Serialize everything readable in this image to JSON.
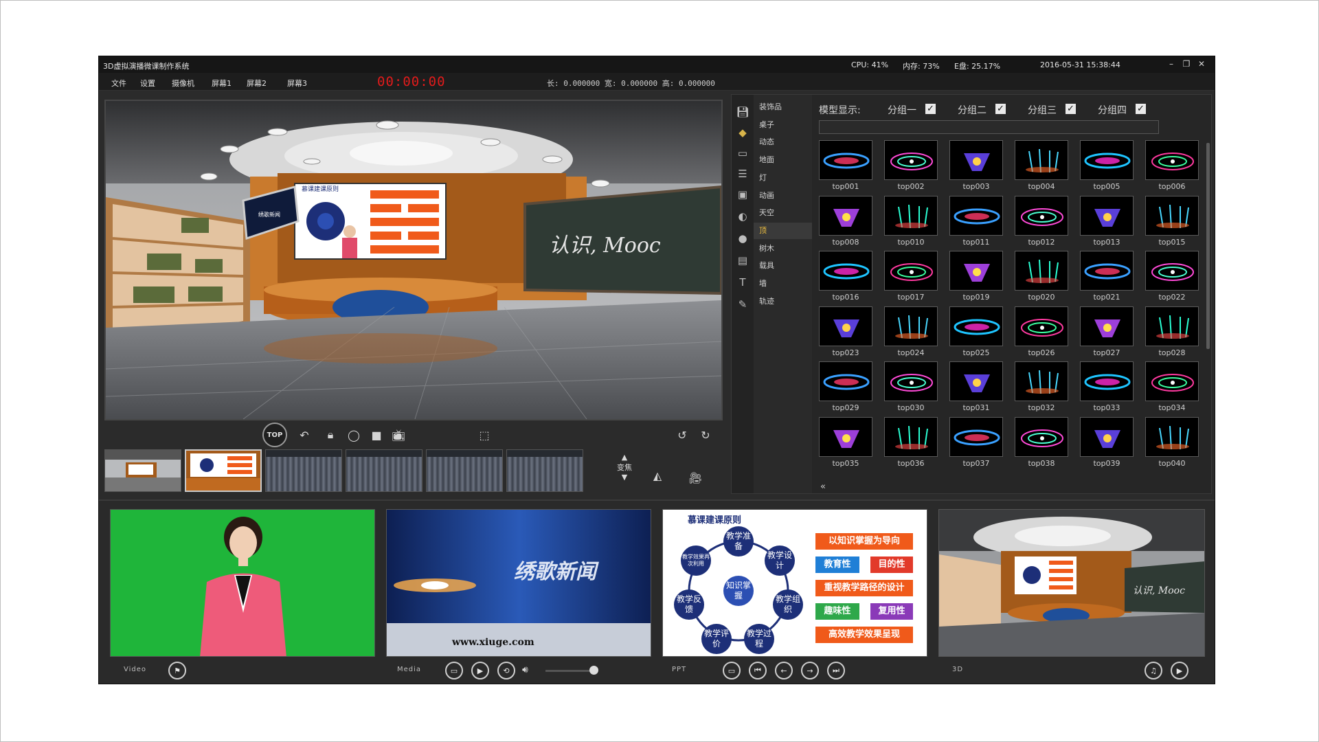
{
  "app": {
    "title": "3D虚拟演播微课制作系统",
    "cpu": "CPU: 41%",
    "memory": "内存: 73%",
    "disk": "E盘: 25.17%",
    "datetime": "2016-05-31 15:38:44"
  },
  "menu": {
    "items": [
      "文件",
      "设置",
      "摄像机",
      "屏幕1",
      "屏幕2",
      "屏幕3"
    ],
    "timer": "00:00:00",
    "dimensions": "长: 0.000000  宽: 0.000000  高: 0.000000"
  },
  "preview": {
    "blackboard_text": "认识, Mooc",
    "screen_title": "慕课建课原则",
    "tv_text": "绣歌新闻"
  },
  "toolbar": {
    "top_label": "TOP",
    "focus_label": "变焦"
  },
  "categories": [
    "装饰品",
    "桌子",
    "动态",
    "地面",
    "灯",
    "动画",
    "天空",
    "顶",
    "树木",
    "载具",
    "墙",
    "轨迹"
  ],
  "active_category": "顶",
  "model_display": {
    "label": "模型显示:",
    "groups": [
      "分组一",
      "分组二",
      "分组三",
      "分组四"
    ],
    "checked": [
      true,
      true,
      true,
      true
    ]
  },
  "models": [
    "top001",
    "top002",
    "top003",
    "top004",
    "top005",
    "top006",
    "top008",
    "top010",
    "top011",
    "top012",
    "top013",
    "top015",
    "top016",
    "top017",
    "top019",
    "top020",
    "top021",
    "top022",
    "top023",
    "top024",
    "top025",
    "top026",
    "top027",
    "top028",
    "top029",
    "top030",
    "top031",
    "top032",
    "top033",
    "top034",
    "top035",
    "top036",
    "top037",
    "top038",
    "top039",
    "top040"
  ],
  "bottom": {
    "video_label": "Video",
    "media_label": "Media",
    "ppt_label": "PPT",
    "threed_label": "3D",
    "media_title": "绣歌新闻",
    "media_url": "www.xiuge.com",
    "ppt": {
      "title": "慕课建课原则",
      "center": "知识掌握",
      "nodes": [
        "教学准备",
        "教学设计",
        "教学组织",
        "教学过程",
        "教学评价",
        "教学反馈",
        "教学效果再次利用"
      ],
      "boxes": [
        "以知识掌握为导向",
        "教育性",
        "目的性",
        "重视教学路径的设计",
        "趣味性",
        "复用性",
        "高效教学效果呈现"
      ]
    }
  },
  "colors": {
    "accent_red": "#e21b1b",
    "green_screen": "#1fb53a",
    "ppt_orange": "#f05a1a",
    "ppt_navy": "#1d2f78"
  }
}
